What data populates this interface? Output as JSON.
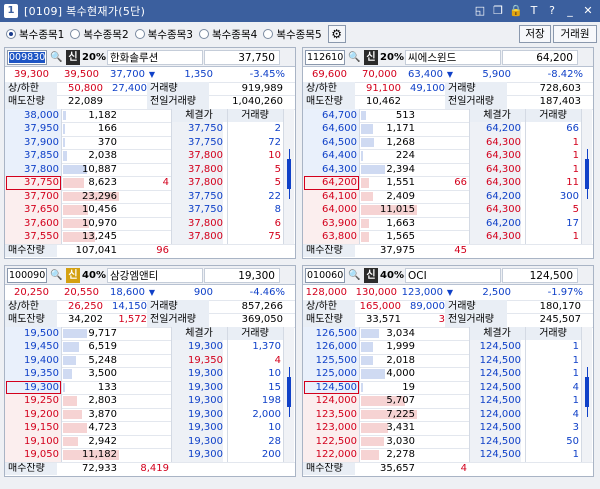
{
  "window": {
    "title": "[0109] 복수현재가(5단)",
    "app_icon": "1",
    "buttons": [
      "restore-icon",
      "maximize-icon",
      "lock-icon",
      "font-icon",
      "help-icon",
      "minimize-icon",
      "close-icon"
    ],
    "button_glyphs": [
      "◱",
      "❐",
      "🔒",
      "T",
      "?",
      "_",
      "✕"
    ]
  },
  "options": {
    "radios": [
      {
        "label": "복수종목1",
        "selected": true
      },
      {
        "label": "복수종목2",
        "selected": false
      },
      {
        "label": "복수종목3",
        "selected": false
      },
      {
        "label": "복수종목4",
        "selected": false
      },
      {
        "label": "복수종목5",
        "selected": false
      }
    ],
    "save_label": "저장",
    "broker_label": "거래원"
  },
  "colors": {
    "up": "#d3001c",
    "down": "#1041c8",
    "accent": "#3b5f9e"
  },
  "panels": [
    {
      "code": "009830",
      "code_selected": true,
      "badge": "신",
      "badge_color": "#2b2b2b",
      "margin": "20%",
      "name": "한화솔루션",
      "price": "37,750",
      "summary": [
        [
          "39,300",
          "39,500",
          "37,700",
          "▼",
          "1,350",
          "-3.45%"
        ],
        [
          "상/하한",
          "50,800",
          "27,400",
          "거래량",
          "919,989",
          ""
        ],
        [
          "매도잔량",
          "22,089",
          "",
          "전일거래량",
          "1,040,260",
          ""
        ]
      ],
      "summary_colors": [
        [
          "red",
          "red",
          "blue",
          "blue",
          "blue",
          "blue"
        ]
      ],
      "asks": [
        [
          "38,000",
          "1,182"
        ],
        [
          "37,950",
          "166"
        ],
        [
          "37,900",
          "370"
        ],
        [
          "37,850",
          "2,038"
        ],
        [
          "37,800",
          "10,887"
        ]
      ],
      "bids": [
        [
          "37,750",
          "8,623",
          "4"
        ],
        [
          "37,700",
          "23,296",
          ""
        ],
        [
          "37,650",
          "10,456",
          ""
        ],
        [
          "37,600",
          "10,970",
          ""
        ],
        [
          "37,550",
          "13,245",
          ""
        ]
      ],
      "trade_hdr": [
        "체결가",
        "거래량"
      ],
      "trades": [
        [
          "37,750",
          "2",
          "b"
        ],
        [
          "37,750",
          "72",
          "b"
        ],
        [
          "37,800",
          "10",
          "r"
        ],
        [
          "37,800",
          "5",
          "r"
        ],
        [
          "37,800",
          "5",
          "r"
        ],
        [
          "37,750",
          "22",
          "b"
        ],
        [
          "37,750",
          "8",
          "b"
        ],
        [
          "37,800",
          "6",
          "r"
        ],
        [
          "37,800",
          "75",
          "r"
        ],
        [
          "37,800",
          "10",
          "r"
        ]
      ],
      "trade_top": [
        [
          "체결가",
          "거래량"
        ]
      ],
      "bottom": [
        "매수잔량",
        "107,041",
        "96"
      ]
    },
    {
      "code": "112610",
      "code_selected": false,
      "badge": "신",
      "badge_color": "#2b2b2b",
      "margin": "20%",
      "name": "씨에스윈드",
      "price": "64,200",
      "summary": [
        [
          "69,600",
          "70,000",
          "63,400",
          "▼",
          "5,900",
          "-8.42%"
        ],
        [
          "상/하한",
          "91,100",
          "49,100",
          "거래량",
          "728,603",
          ""
        ],
        [
          "매도잔량",
          "10,462",
          "",
          "전일거래량",
          "187,403",
          ""
        ]
      ],
      "asks": [
        [
          "64,700",
          "513"
        ],
        [
          "64,600",
          "1,171"
        ],
        [
          "64,500",
          "1,268"
        ],
        [
          "64,400",
          "224"
        ],
        [
          "64,300",
          "2,394"
        ]
      ],
      "bids": [
        [
          "64,200",
          "1,551",
          "66"
        ],
        [
          "64,100",
          "2,409",
          ""
        ],
        [
          "64,000",
          "11,015",
          ""
        ],
        [
          "63,900",
          "1,663",
          ""
        ],
        [
          "63,800",
          "1,565",
          ""
        ]
      ],
      "trade_hdr": [
        "체결가",
        "거래량"
      ],
      "trades": [
        [
          "64,200",
          "66",
          "b"
        ],
        [
          "64,300",
          "1",
          "r"
        ],
        [
          "64,300",
          "1",
          "r"
        ],
        [
          "64,300",
          "1",
          "r"
        ],
        [
          "64,300",
          "11",
          "r"
        ],
        [
          "64,200",
          "300",
          "b"
        ],
        [
          "64,300",
          "5",
          "r"
        ],
        [
          "64,200",
          "17",
          "b"
        ],
        [
          "64,300",
          "1",
          "r"
        ],
        [
          "64,200",
          "34",
          "b"
        ],
        [
          "64,200",
          "4",
          "b"
        ]
      ],
      "bottom": [
        "매수잔량",
        "37,975",
        "45"
      ]
    },
    {
      "code": "100090",
      "code_selected": false,
      "badge": "신",
      "badge_color": "#d4a010",
      "margin": "40%",
      "name": "삼강엠앤티",
      "price": "19,300",
      "summary": [
        [
          "20,250",
          "20,550",
          "18,600",
          "▼",
          "900",
          "-4.46%"
        ],
        [
          "상/하한",
          "26,250",
          "14,150",
          "거래량",
          "857,266",
          ""
        ],
        [
          "매도잔량",
          "34,202",
          "1,572",
          "전일거래량",
          "369,050",
          ""
        ]
      ],
      "asks": [
        [
          "19,500",
          "9,717"
        ],
        [
          "19,450",
          "6,519"
        ],
        [
          "19,400",
          "5,248"
        ],
        [
          "19,350",
          "3,500"
        ],
        [
          "19,300",
          "133"
        ]
      ],
      "bids": [
        [
          "19,250",
          "2,803",
          ""
        ],
        [
          "19,200",
          "3,870",
          ""
        ],
        [
          "19,150",
          "4,723",
          ""
        ],
        [
          "19,100",
          "2,942",
          ""
        ],
        [
          "19,050",
          "11,182",
          ""
        ]
      ],
      "trade_hdr": [
        "체결가",
        "거래량"
      ],
      "trades": [
        [
          "19,300",
          "1,370",
          "b"
        ],
        [
          "19,350",
          "4",
          "r"
        ],
        [
          "19,300",
          "10",
          "b"
        ],
        [
          "19,300",
          "15",
          "b"
        ],
        [
          "19,300",
          "198",
          "b"
        ],
        [
          "19,300",
          "2,000",
          "b"
        ],
        [
          "19,300",
          "10",
          "b"
        ],
        [
          "19,300",
          "28",
          "b"
        ],
        [
          "19,300",
          "200",
          "b"
        ],
        [
          "19,300",
          "32",
          "b"
        ]
      ],
      "bottom": [
        "매수잔량",
        "72,933",
        "8,419"
      ]
    },
    {
      "code": "010060",
      "code_selected": false,
      "badge": "신",
      "badge_color": "#2b2b2b",
      "margin": "40%",
      "name": "OCI",
      "price": "124,500",
      "summary": [
        [
          "128,000",
          "130,000",
          "123,000",
          "▼",
          "2,500",
          "-1.97%"
        ],
        [
          "상/하한",
          "165,000",
          "89,000",
          "거래량",
          "180,170",
          ""
        ],
        [
          "매도잔량",
          "33,571",
          "3",
          "전일거래량",
          "245,507",
          ""
        ]
      ],
      "asks": [
        [
          "126,500",
          "3,034"
        ],
        [
          "126,000",
          "1,999"
        ],
        [
          "125,500",
          "2,018"
        ],
        [
          "125,000",
          "4,000"
        ],
        [
          "124,500",
          "19"
        ]
      ],
      "bids": [
        [
          "124,000",
          "5,707",
          ""
        ],
        [
          "123,500",
          "7,225",
          ""
        ],
        [
          "123,000",
          "3,431",
          ""
        ],
        [
          "122,500",
          "3,030",
          ""
        ],
        [
          "122,000",
          "2,278",
          ""
        ]
      ],
      "trade_hdr": [
        "체결가",
        "거래량"
      ],
      "trades": [
        [
          "124,500",
          "1",
          "b"
        ],
        [
          "124,500",
          "1",
          "b"
        ],
        [
          "124,500",
          "1",
          "b"
        ],
        [
          "124,500",
          "4",
          "b"
        ],
        [
          "124,500",
          "1",
          "b"
        ],
        [
          "124,000",
          "4",
          "b"
        ],
        [
          "124,500",
          "3",
          "b"
        ],
        [
          "124,500",
          "50",
          "b"
        ],
        [
          "124,500",
          "1",
          "b"
        ],
        [
          "124,500",
          "1",
          "b"
        ],
        [
          "124,500",
          "10",
          "b"
        ]
      ],
      "bottom": [
        "매수잔량",
        "35,657",
        "4"
      ]
    }
  ]
}
